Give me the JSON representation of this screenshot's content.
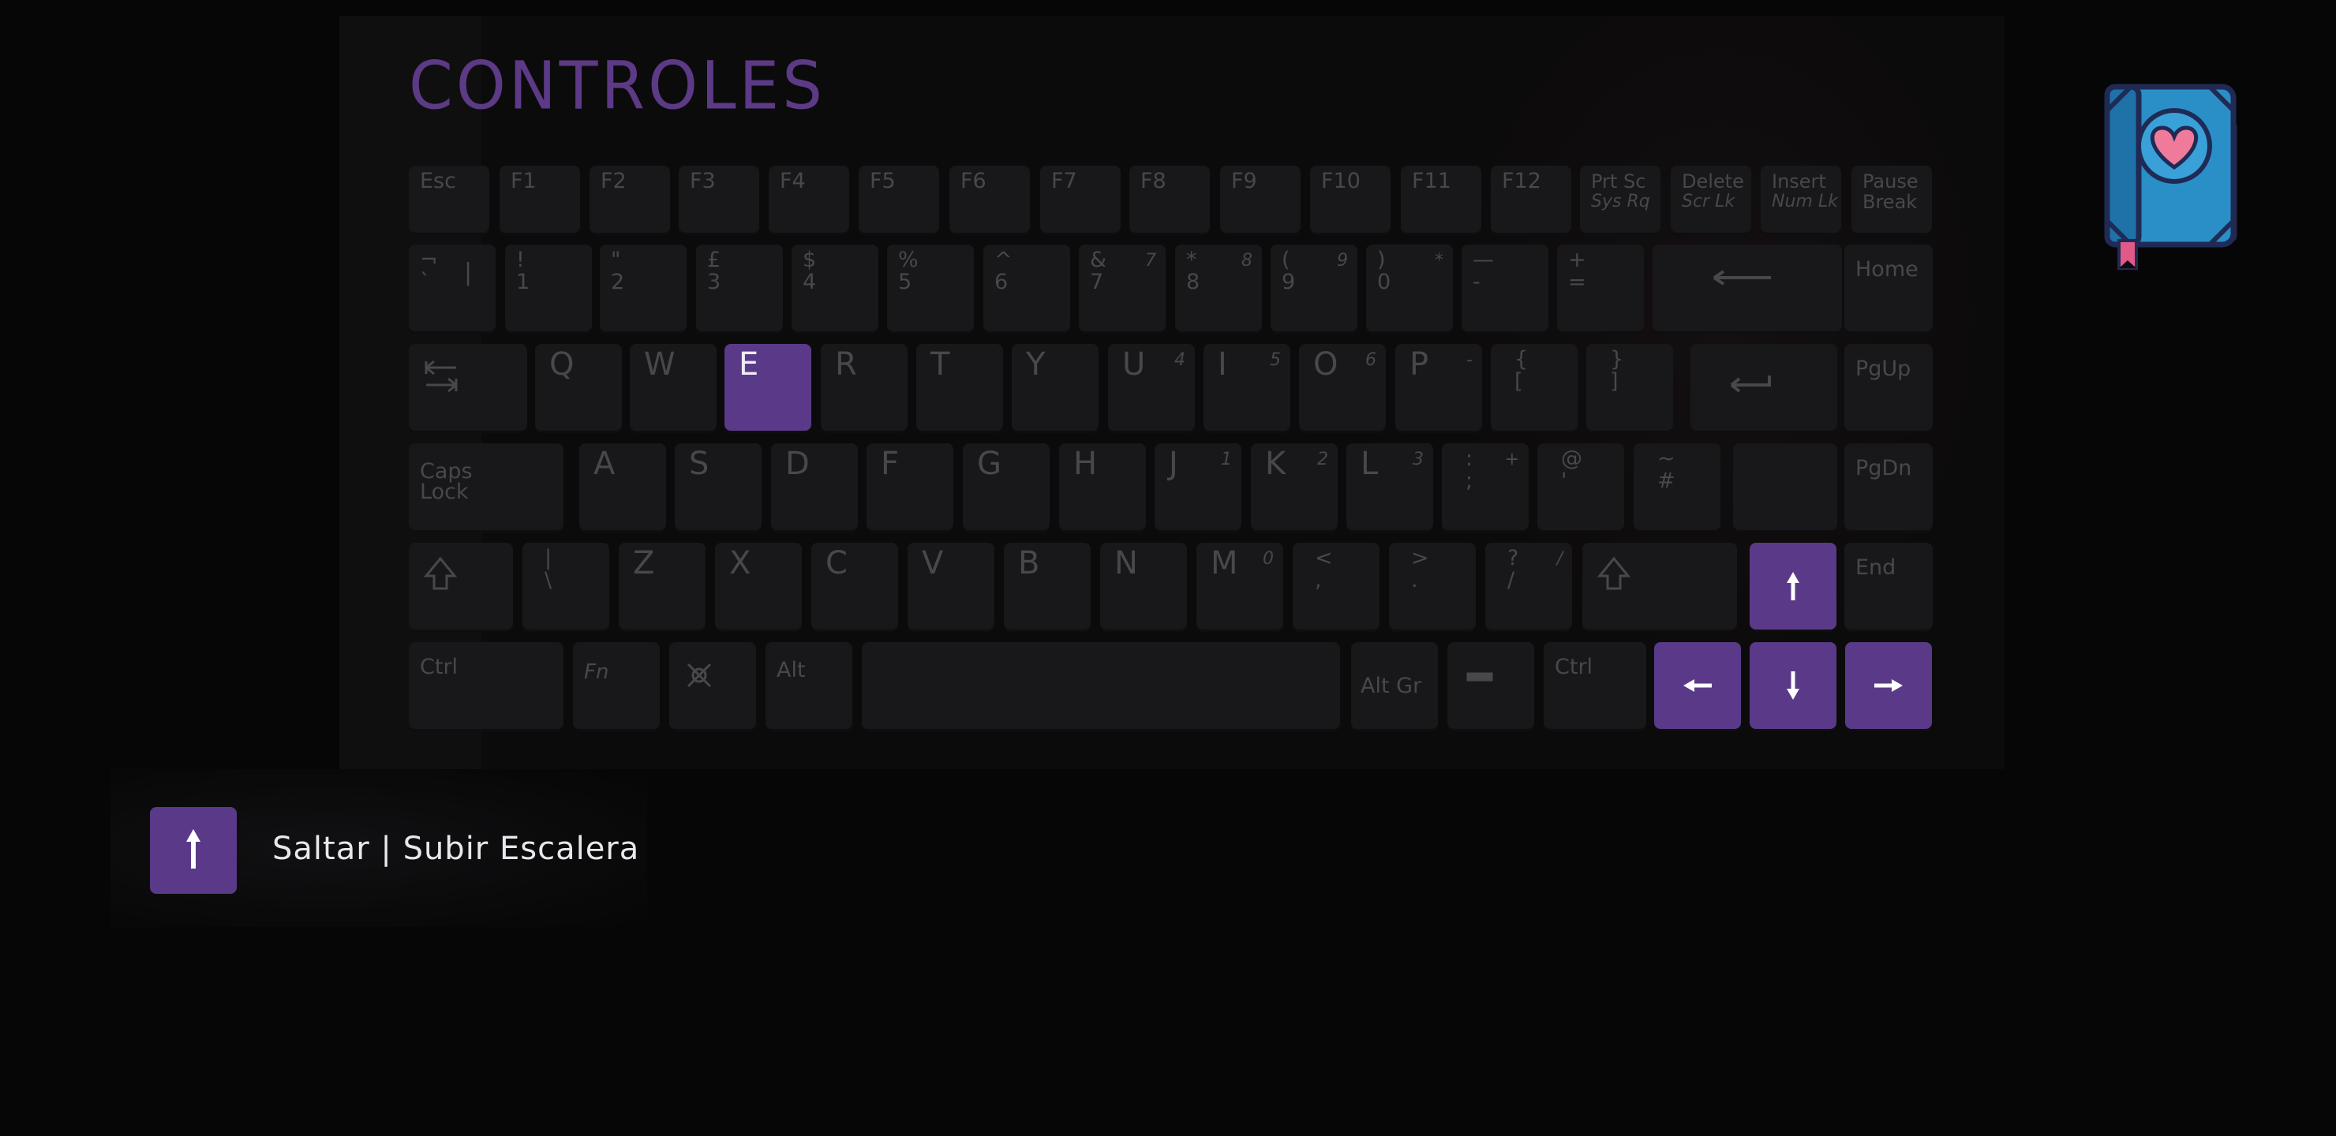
{
  "title": "CONTROLES",
  "legend": {
    "text": "Saltar | Subir Escalera",
    "key_icon": "arrow-up-icon"
  },
  "colors": {
    "highlight": "#5a3a88",
    "key": "#18181a",
    "key_text": "#48484c",
    "title": "#5c3a86"
  },
  "menu_icon": "book-heart-icon",
  "keyboard": {
    "fn_row": [
      "Esc",
      "F1",
      "F2",
      "F3",
      "F4",
      "F5",
      "F6",
      "F7",
      "F8",
      "F9",
      "F10",
      "F11",
      "F12"
    ],
    "prtsc": [
      "Prt Sc",
      "Sys Rq"
    ],
    "delete": [
      "Delete",
      "Scr Lk"
    ],
    "insert": [
      "Insert",
      "Num Lk"
    ],
    "pause": [
      "Pause",
      "Break"
    ],
    "num_row": [
      {
        "top": "¬",
        "bot": "`",
        "extra": "|"
      },
      {
        "top": "!",
        "bot": "1"
      },
      {
        "top": "\"",
        "bot": "2"
      },
      {
        "top": "£",
        "bot": "3"
      },
      {
        "top": "$",
        "bot": "4"
      },
      {
        "top": "%",
        "bot": "5"
      },
      {
        "top": "^",
        "bot": "6"
      },
      {
        "top": "&",
        "bot": "7",
        "sup": "7"
      },
      {
        "top": "*",
        "bot": "8",
        "sup": "8"
      },
      {
        "top": "(",
        "bot": "9",
        "sup": "9"
      },
      {
        "top": ")",
        "bot": "0",
        "sup": "*"
      },
      {
        "top": "—",
        "bot": "-"
      },
      {
        "top": "+",
        "bot": "="
      }
    ],
    "home": "Home",
    "qrow": [
      {
        "l": "Q"
      },
      {
        "l": "W"
      },
      {
        "l": "E"
      },
      {
        "l": "R"
      },
      {
        "l": "T"
      },
      {
        "l": "Y"
      },
      {
        "l": "U",
        "sup": "4"
      },
      {
        "l": "I",
        "sup": "5"
      },
      {
        "l": "O",
        "sup": "6"
      },
      {
        "l": "P",
        "sup": "-"
      },
      {
        "top": "{",
        "bot": "["
      },
      {
        "top": "}",
        "bot": "]"
      }
    ],
    "pgup": "PgUp",
    "caps": [
      "Caps",
      "Lock"
    ],
    "arow": [
      {
        "l": "A"
      },
      {
        "l": "S"
      },
      {
        "l": "D"
      },
      {
        "l": "F"
      },
      {
        "l": "G"
      },
      {
        "l": "H"
      },
      {
        "l": "J",
        "sup": "1"
      },
      {
        "l": "K",
        "sup": "2"
      },
      {
        "l": "L",
        "sup": "3"
      },
      {
        "top": ":",
        "bot": ";",
        "sup": "+"
      },
      {
        "top": "@",
        "bot": "'"
      },
      {
        "top": "~",
        "bot": "#"
      }
    ],
    "pgdn": "PgDn",
    "zrow": [
      {
        "top": "|",
        "bot": "\\"
      },
      {
        "l": "Z"
      },
      {
        "l": "X"
      },
      {
        "l": "C"
      },
      {
        "l": "V"
      },
      {
        "l": "B"
      },
      {
        "l": "N"
      },
      {
        "l": "M",
        "sup": "0"
      },
      {
        "top": "<",
        "bot": ","
      },
      {
        "top": ">",
        "bot": "."
      },
      {
        "top": "?",
        "bot": "/",
        "sup": "/"
      }
    ],
    "end": "End",
    "ctrl_l": "Ctrl",
    "fn": "Fn",
    "alt": "Alt",
    "altgr": "Alt Gr",
    "ctrl_r": "Ctrl"
  }
}
